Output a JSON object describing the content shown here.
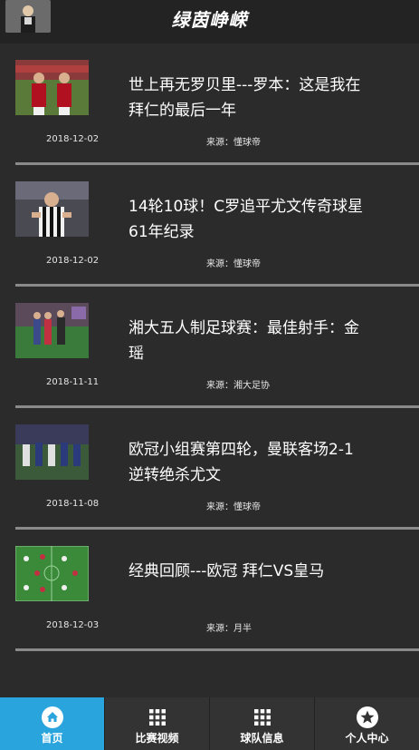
{
  "header": {
    "title": "绿茵峥嵘",
    "avatar_icon": "player-avatar-icon"
  },
  "news": [
    {
      "headline": "世上再无罗贝里---罗本：这是我在拜仁的最后一年",
      "date": "2018-12-02",
      "source": "来源：懂球帝",
      "thumb": "players-celebrating-photo"
    },
    {
      "headline": "14轮10球！C罗追平尤文传奇球星61年纪录",
      "date": "2018-12-02",
      "source": "来源：懂球帝",
      "thumb": "ronaldo-juventus-photo"
    },
    {
      "headline": "湘大五人制足球赛：最佳射手：金瑶",
      "date": "2018-11-11",
      "source": "来源：湘大足协",
      "thumb": "campus-award-photo"
    },
    {
      "headline": "欧冠小组赛第四轮，曼联客场2-1逆转绝杀尤文",
      "date": "2018-11-08",
      "source": "来源：懂球帝",
      "thumb": "match-action-photo"
    },
    {
      "headline": "经典回顾---欧冠 拜仁VS皇马",
      "date": "2018-12-03",
      "source": "来源：月半",
      "thumb": "lineup-graphic"
    }
  ],
  "tabs": [
    {
      "label": "首页",
      "icon": "home-icon",
      "active": true
    },
    {
      "label": "比赛视频",
      "icon": "grid-icon",
      "active": false
    },
    {
      "label": "球队信息",
      "icon": "grid-icon",
      "active": false
    },
    {
      "label": "个人中心",
      "icon": "star-icon",
      "active": false
    }
  ],
  "colors": {
    "background": "#2b2b2b",
    "header": "#232323",
    "active_tab": "#2aa4dc",
    "divider": "#8a8a8a"
  }
}
